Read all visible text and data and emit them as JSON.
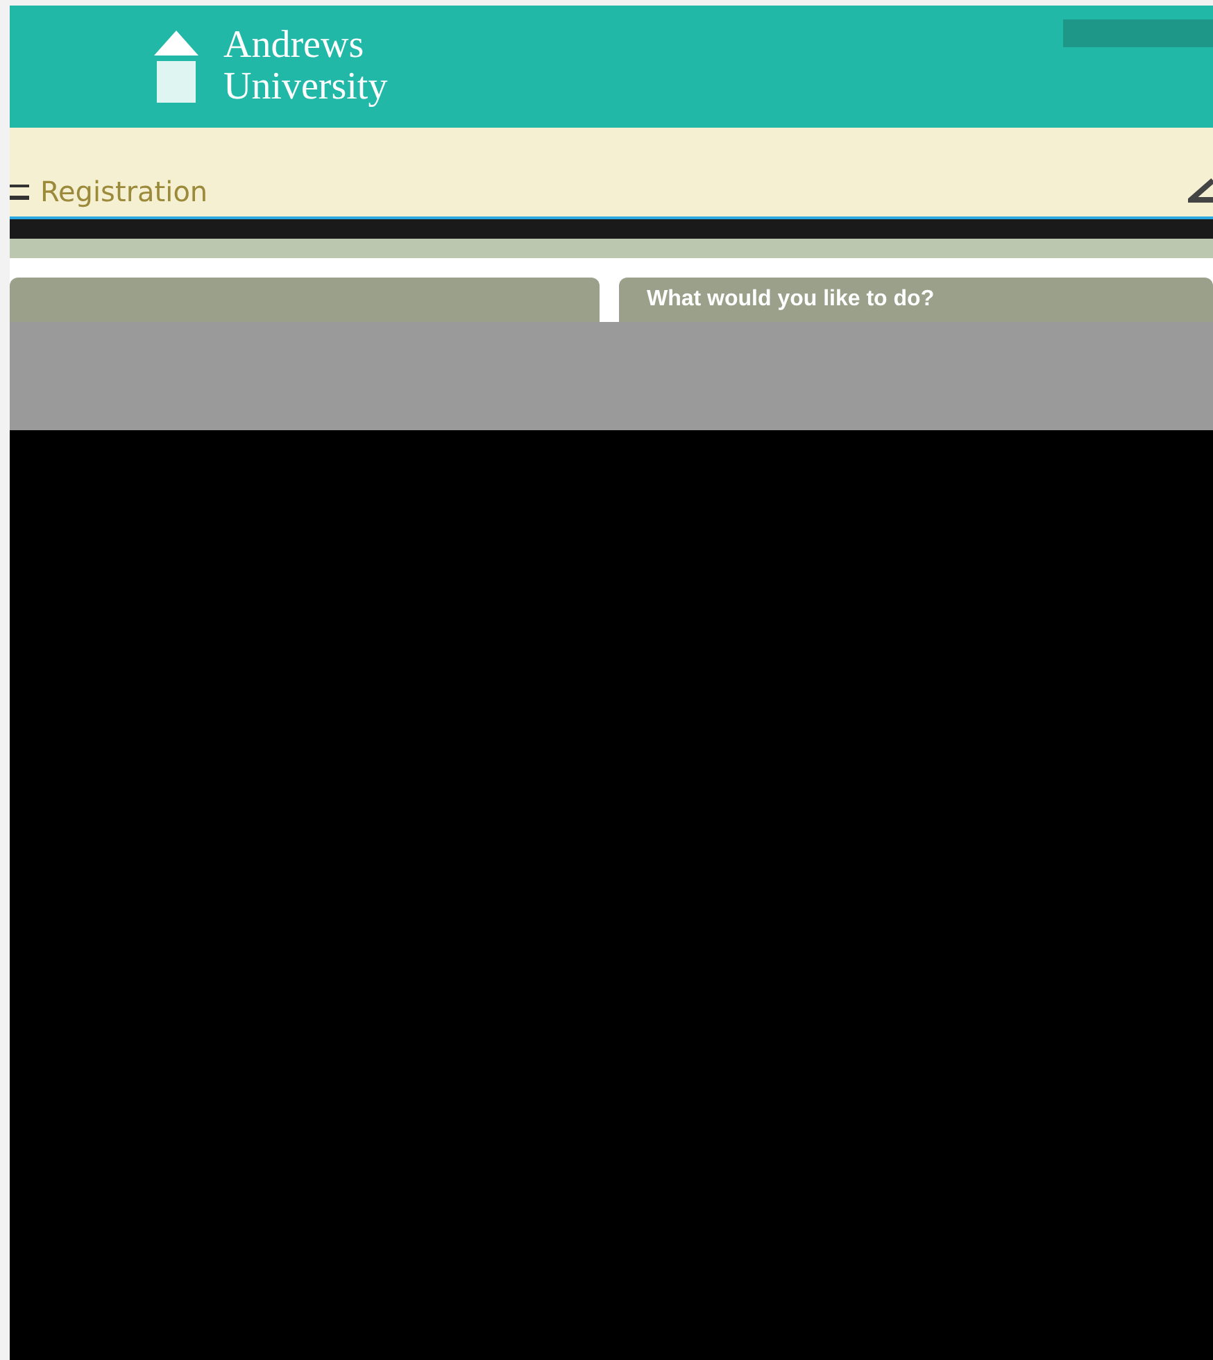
{
  "header": {
    "logo_line_1": "Andrews",
    "logo_line_2": "University"
  },
  "title_bar": {
    "title": "Registration"
  },
  "panel": {
    "heading": "What would you like to do?"
  }
}
